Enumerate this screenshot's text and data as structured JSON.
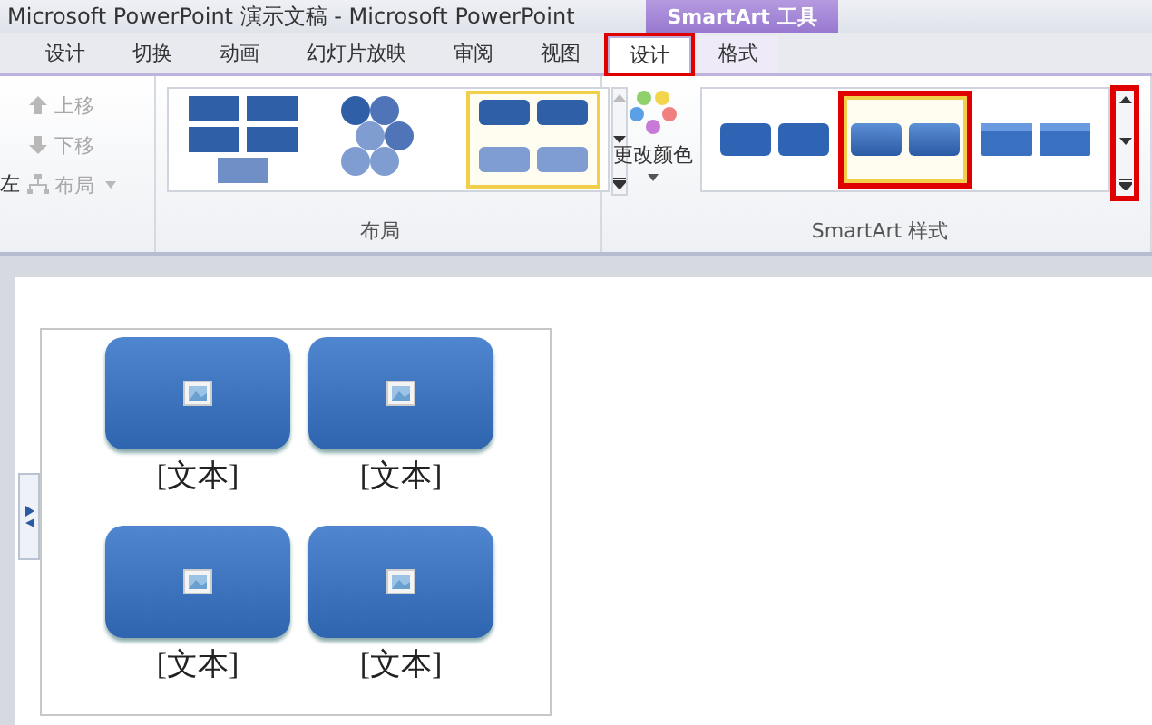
{
  "window": {
    "title": "Microsoft PowerPoint 演示文稿  -  Microsoft PowerPoint",
    "context_tab": "SmartArt 工具"
  },
  "tabs": [
    {
      "label": "设计",
      "selected": false,
      "highlighted": false
    },
    {
      "label": "切换",
      "selected": false,
      "highlighted": false
    },
    {
      "label": "动画",
      "selected": false,
      "highlighted": false
    },
    {
      "label": "幻灯片放映",
      "selected": false,
      "highlighted": false
    },
    {
      "label": "审阅",
      "selected": false,
      "highlighted": false
    },
    {
      "label": "视图",
      "selected": false,
      "highlighted": false
    },
    {
      "label": "设计",
      "selected": true,
      "highlighted": true
    },
    {
      "label": "格式",
      "selected": false,
      "highlighted": false
    }
  ],
  "arrange": {
    "partial_label": "左",
    "commands": [
      {
        "kind": "up",
        "label": "上移",
        "disabled": true
      },
      {
        "kind": "down",
        "label": "下移",
        "disabled": true
      },
      {
        "kind": "layout",
        "label": "布局",
        "disabled": true
      }
    ]
  },
  "layouts": {
    "label": "布局",
    "items": [
      {
        "kind": "blocks",
        "selected": false
      },
      {
        "kind": "hexagons",
        "selected": false
      },
      {
        "kind": "grid",
        "selected": true
      }
    ]
  },
  "change_colors": {
    "label": "更改颜色"
  },
  "styles": {
    "label": "SmartArt 样式",
    "scroll_highlighted": true,
    "items": [
      {
        "kind": "flat",
        "selected": false,
        "highlighted": false
      },
      {
        "kind": "raised",
        "selected": true,
        "highlighted": true
      },
      {
        "kind": "bevel",
        "selected": false,
        "highlighted": false
      }
    ]
  },
  "slide": {
    "items": [
      {
        "text": "[文本]"
      },
      {
        "text": "[文本]"
      },
      {
        "text": "[文本]"
      },
      {
        "text": "[文本]"
      }
    ]
  }
}
